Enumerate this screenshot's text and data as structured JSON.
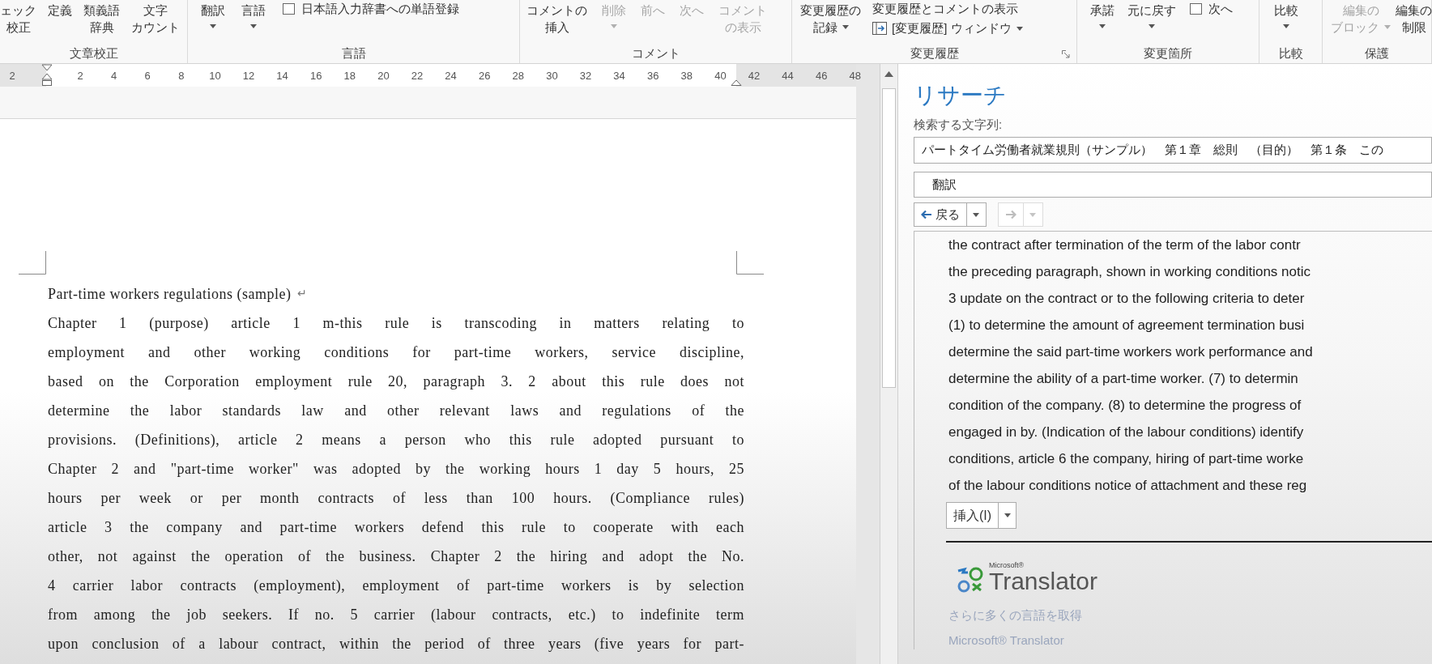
{
  "ribbon": {
    "groups": [
      {
        "label": "文章校正",
        "launcher": false,
        "items": [
          {
            "kind": "large",
            "lines": [
              "ェック",
              "校正"
            ],
            "dropdown": false,
            "disabled": false
          },
          {
            "kind": "large",
            "lines": [
              "定義"
            ],
            "dropdown": false,
            "disabled": false
          },
          {
            "kind": "large",
            "lines": [
              "類義語",
              "辞典"
            ],
            "dropdown": false,
            "disabled": false
          },
          {
            "kind": "large",
            "lines": [
              "文字",
              "カウント"
            ],
            "dropdown": false,
            "disabled": false
          }
        ]
      },
      {
        "label": "言語",
        "launcher": false,
        "items": [
          {
            "kind": "large",
            "lines": [
              "翻訳"
            ],
            "dropdown": true,
            "disabled": false
          },
          {
            "kind": "large",
            "lines": [
              "言語"
            ],
            "dropdown": true,
            "disabled": false
          },
          {
            "kind": "small",
            "text": "日本語入力辞書への単語登録",
            "dropdown": false,
            "disabled": false
          }
        ]
      },
      {
        "label": "コメント",
        "launcher": false,
        "items": [
          {
            "kind": "large",
            "lines": [
              "コメントの",
              "挿入"
            ],
            "dropdown": false,
            "disabled": false
          },
          {
            "kind": "large",
            "lines": [
              "削除"
            ],
            "dropdown": true,
            "disabled": true
          },
          {
            "kind": "large",
            "lines": [
              "前へ"
            ],
            "dropdown": false,
            "disabled": true
          },
          {
            "kind": "large",
            "lines": [
              "次へ"
            ],
            "dropdown": false,
            "disabled": true
          },
          {
            "kind": "large",
            "lines": [
              "コメント",
              "の表示"
            ],
            "dropdown": false,
            "disabled": true
          }
        ]
      },
      {
        "label": "変更履歴",
        "launcher": true,
        "items": [
          {
            "kind": "large",
            "lines": [
              "変更履歴の",
              "記録"
            ],
            "dropdown": true,
            "disabled": false
          },
          {
            "kind": "stack",
            "items": [
              {
                "text": "変更履歴とコメントの表示",
                "dropdown": false,
                "disabled": false
              },
              {
                "text": "[変更履歴] ウィンドウ",
                "dropdown": true,
                "disabled": false
              }
            ]
          }
        ]
      },
      {
        "label": "変更箇所",
        "launcher": false,
        "items": [
          {
            "kind": "large",
            "lines": [
              "承諾"
            ],
            "dropdown": true,
            "disabled": false
          },
          {
            "kind": "large",
            "lines": [
              "元に戻す"
            ],
            "dropdown": true,
            "disabled": false
          },
          {
            "kind": "small",
            "text": "次へ",
            "dropdown": false,
            "disabled": false
          }
        ]
      },
      {
        "label": "比較",
        "launcher": false,
        "items": [
          {
            "kind": "large",
            "lines": [
              "比較"
            ],
            "dropdown": true,
            "disabled": false
          }
        ]
      },
      {
        "label": "保護",
        "launcher": false,
        "items": [
          {
            "kind": "large",
            "lines": [
              "編集の",
              "ブロック"
            ],
            "dropdown": true,
            "disabled": true
          },
          {
            "kind": "large",
            "lines": [
              "編集の",
              "制限"
            ],
            "dropdown": false,
            "disabled": false
          }
        ]
      }
    ]
  },
  "ruler": {
    "labels": [
      "2",
      "2",
      "4",
      "6",
      "8",
      "10",
      "12",
      "14",
      "16",
      "18",
      "20",
      "22",
      "24",
      "26",
      "28",
      "30",
      "32",
      "34",
      "36",
      "38",
      "40",
      "42",
      "44",
      "46",
      "48"
    ]
  },
  "document": {
    "title": "Part-time workers regulations (sample)",
    "paragraph_mark": "↵",
    "lines": [
      "Chapter 1 (purpose) article 1 m-this rule is transcoding in matters relating to",
      "employment and other working conditions for part-time workers, service discipline,",
      "based on the Corporation employment rule 20, paragraph 3. 2 about this rule does not",
      "determine the labor standards law and other relevant laws and regulations of the",
      "provisions. (Definitions), article 2 means a person who this rule adopted pursuant to",
      "Chapter 2 and \"part-time worker\" was adopted by the working hours 1 day 5 hours, 25",
      "hours per week or per month contracts of less than 100 hours.  (Compliance rules)",
      "article 3 the company and part-time workers defend this rule to cooperate with each",
      "other, not against the operation of the business. Chapter 2 the hiring and adopt the No.",
      "4 carrier labor contracts (employment), employment of part-time workers is by selection",
      "from among the job seekers. If no. 5 carrier (labour contracts, etc.) to indefinite term",
      "upon conclusion of a labour contract, within the period of three years (five years for part-"
    ]
  },
  "research": {
    "title": "リサーチ",
    "search_label": "検索する文字列:",
    "search_value": "パートタイム労働者就業規則（サンプル）　第１章　総則　（目的）　第１条　この",
    "service": "翻訳",
    "back": {
      "label": "戻る",
      "disabled": false
    },
    "forward": {
      "disabled": true
    },
    "results": [
      "the contract after termination of the term of the labor contr",
      "the preceding paragraph, shown in working conditions notic",
      "3 update on the contract or to the following criteria to deter",
      "(1) to determine the amount of agreement termination busi",
      "determine the said part-time workers work performance and",
      "determine the ability of a part-time worker. (7) to determin",
      "condition of the company. (8) to determine the progress of",
      "engaged in by. (Indication of the labour conditions) identify",
      "conditions, article 6 the company, hiring of part-time worke",
      "of the labour conditions notice of attachment and these reg"
    ],
    "insert": "挿入(I)",
    "logo_small": "Microsoft®",
    "logo": "Translator",
    "links": [
      "さらに多くの言語を取得",
      "Microsoft® Translator"
    ]
  }
}
